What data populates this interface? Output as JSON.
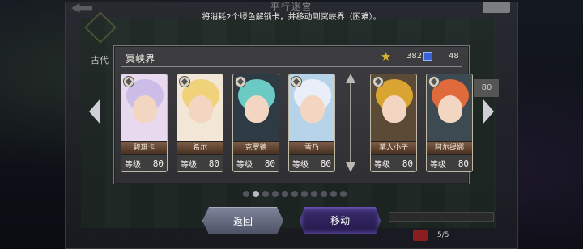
{
  "background": {
    "title": "平行迷宫",
    "ancient_label": "古代",
    "side_value": "80",
    "page_indicator": "5/5"
  },
  "hint": "将消耗2个绿色解锁卡，并移动到冥峡界（困难）。",
  "dialog": {
    "title": "冥峡界",
    "resources": [
      {
        "icon": "gold-key-icon",
        "value": "382"
      },
      {
        "icon": "blue-key-icon",
        "value": "48"
      }
    ]
  },
  "level_label": "等级",
  "cards_left": [
    {
      "name": "碧琪卡",
      "level": "80",
      "hair": "#cbbce8",
      "bg": "#e9d9ef"
    },
    {
      "name": "希尔",
      "level": "80",
      "hair": "#f0d27a",
      "bg": "#f2e7d6"
    },
    {
      "name": "克罗德",
      "level": "80",
      "hair": "#6ccac4",
      "bg": "#2e3a44"
    },
    {
      "name": "雪乃",
      "level": "80",
      "hair": "#e9eef8",
      "bg": "#b7d3ea"
    }
  ],
  "cards_right": [
    {
      "name": "草人小子",
      "level": "80",
      "hair": "#d9a431",
      "bg": "#5a4a36"
    },
    {
      "name": "阿尔缇娜",
      "level": "80",
      "hair": "#e06a3c",
      "bg": "#3d4a52"
    }
  ],
  "pagination": {
    "total": 11,
    "current": 1
  },
  "buttons": {
    "back": "返回",
    "move": "移动"
  }
}
